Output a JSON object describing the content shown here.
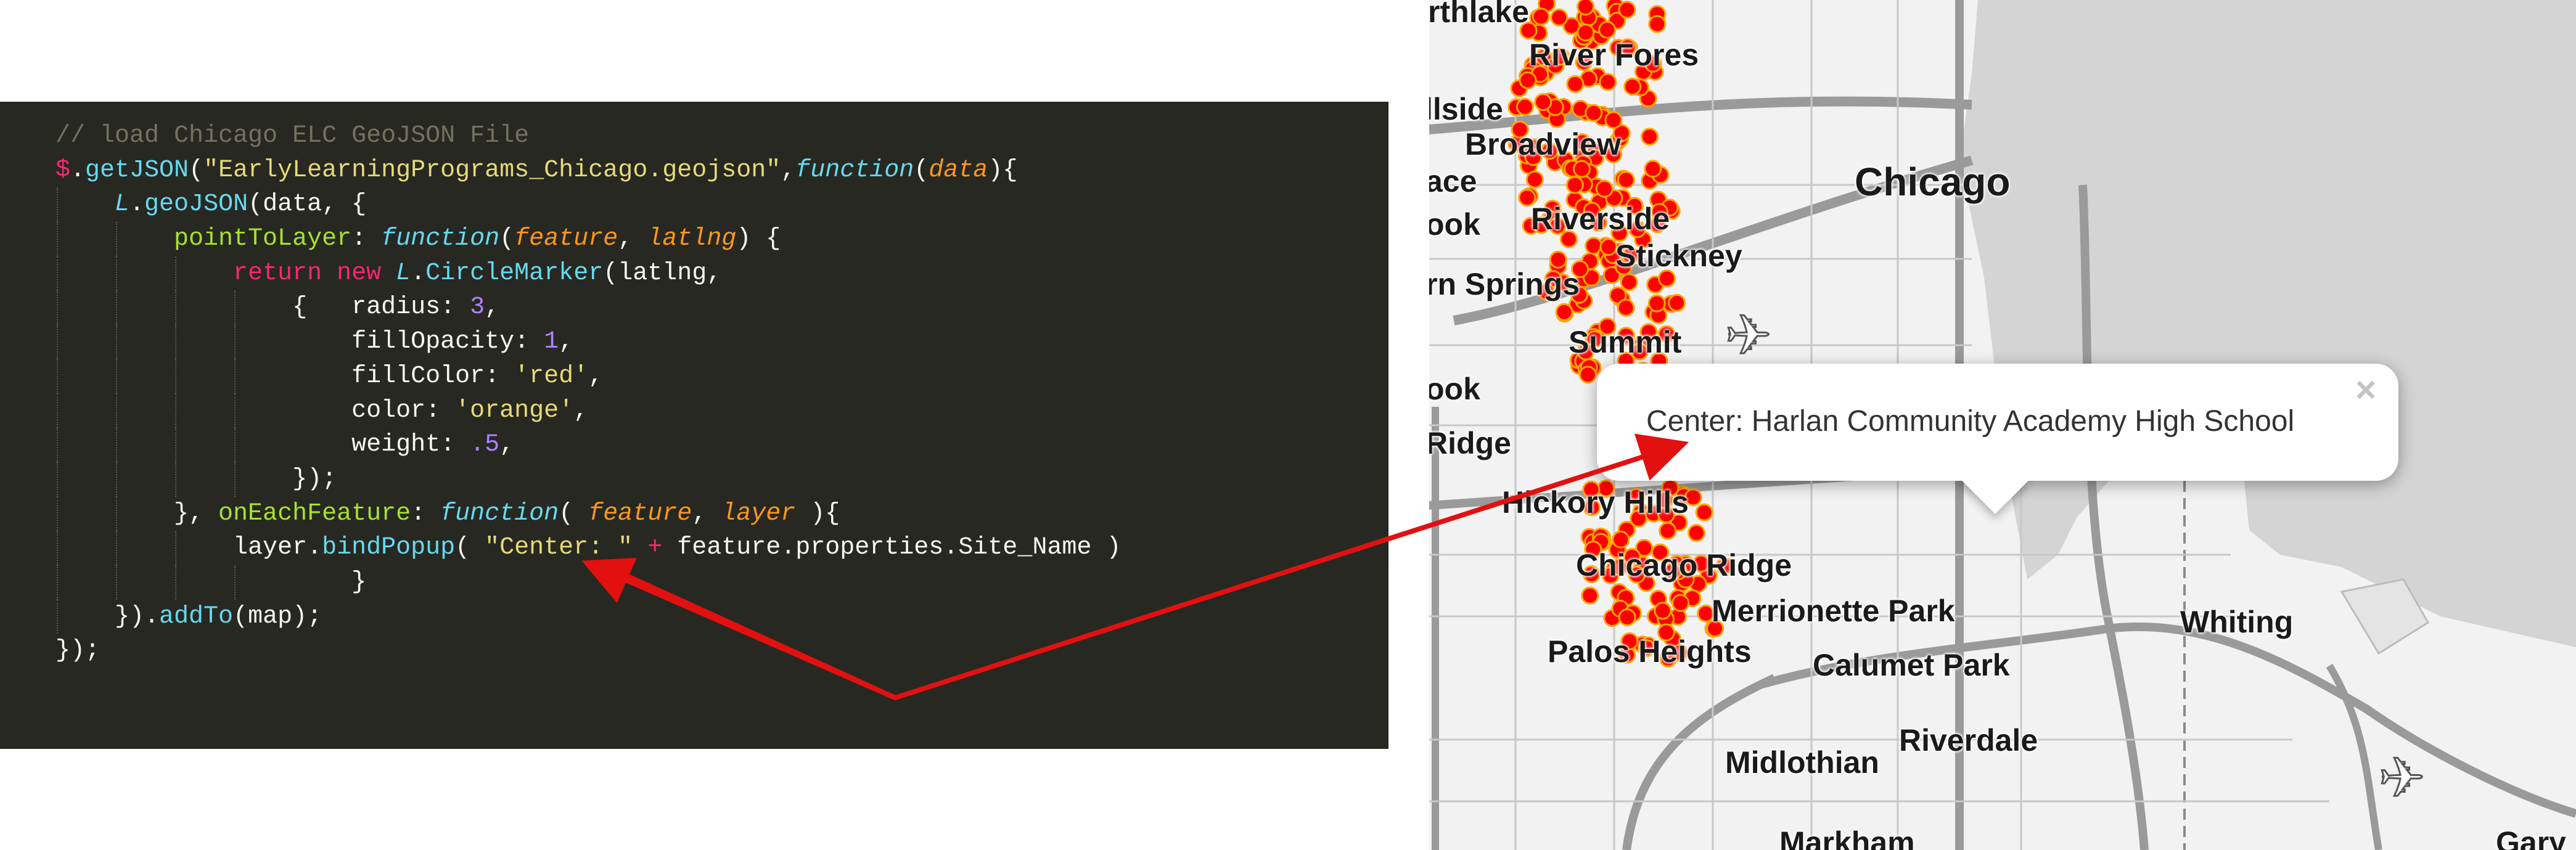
{
  "code": {
    "lines": [
      "// load Chicago ELC GeoJSON File",
      "$.getJSON(\"EarlyLearningPrograms_Chicago.geojson\",function(data){",
      "    L.geoJSON(data, {",
      "        pointToLayer: function(feature, latlng) {",
      "            return new L.CircleMarker(latlng,",
      "                {   radius: 3,",
      "                    fillOpacity: 1,",
      "                    fillColor: 'red',",
      "                    color: 'orange',",
      "                    weight: .5,",
      "                });",
      "        }, onEachFeature: function( feature, layer ){",
      "            layer.bindPopup( \"Center: \" + feature.properties.Site_Name )",
      "                    }",
      "    }).addTo(map);",
      "});"
    ]
  },
  "map": {
    "places": [
      {
        "name": "rthlake"
      },
      {
        "name": "River Fores"
      },
      {
        "name": "llside"
      },
      {
        "name": "Broadview"
      },
      {
        "name": "ace"
      },
      {
        "name": "Chicago"
      },
      {
        "name": "ook"
      },
      {
        "name": "Riverside"
      },
      {
        "name": "Stickney"
      },
      {
        "name": "rn Springs"
      },
      {
        "name": "Summit"
      },
      {
        "name": "ook"
      },
      {
        "name": "Ridge"
      },
      {
        "name": "Hickory Hills"
      },
      {
        "name": "Chicago Ridge"
      },
      {
        "name": "Merrionette Park"
      },
      {
        "name": "Palos Heights"
      },
      {
        "name": "Calumet Park"
      },
      {
        "name": "Whiting"
      },
      {
        "name": "Riverdale"
      },
      {
        "name": "Midlothian"
      },
      {
        "name": "Markham"
      },
      {
        "name": "Gary"
      }
    ],
    "marker_fill": "#ff0000",
    "marker_stroke": "#ffa500",
    "airport_icon": "airplane-icon",
    "airport_glyph": "✈"
  },
  "popup": {
    "text": "Center: Harlan Community Academy High School",
    "close_glyph": "×"
  },
  "annotation": {
    "arrow_color": "#e31010"
  }
}
